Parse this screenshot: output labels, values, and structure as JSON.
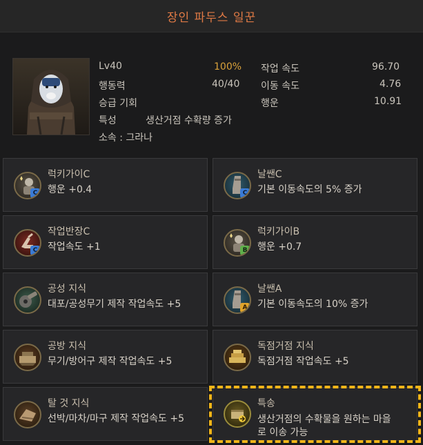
{
  "window": {
    "title": "장인 파두스 일꾼"
  },
  "worker": {
    "level": "Lv40",
    "level_percent": "100%",
    "stamina_label": "행동력",
    "stamina_value": "40/40",
    "promotion_label": "승급 기회",
    "trait_label": "특성",
    "trait_value": "생산거점 수확량 증가",
    "affiliation": "소속 : 그라나",
    "work_speed_label": "작업 속도",
    "work_speed_value": "96.70",
    "move_speed_label": "이동 속도",
    "move_speed_value": "4.76",
    "luck_label": "행운",
    "luck_value": "10.91"
  },
  "skills": [
    {
      "name": "럭키가이C",
      "desc": "행운 +0.4",
      "icon": "lucky-guy-icon",
      "grade": "C",
      "grade_color": "#3a7bd5"
    },
    {
      "name": "날쌘C",
      "desc": "기본 이동속도의 5% 증가",
      "icon": "swift-boot-icon",
      "grade": "C",
      "grade_color": "#3a7bd5"
    },
    {
      "name": "작업반장C",
      "desc": "작업속도 +1",
      "icon": "foreman-hand-icon",
      "grade": "C",
      "grade_color": "#3a7bd5"
    },
    {
      "name": "럭키가이B",
      "desc": "행운 +0.7",
      "icon": "lucky-guy-icon",
      "grade": "B",
      "grade_color": "#5fb04a"
    },
    {
      "name": "공성 지식",
      "desc": "대포/공성무기 제작 작업속도 +5",
      "icon": "siege-knowledge-icon",
      "grade": "",
      "grade_color": ""
    },
    {
      "name": "날쌘A",
      "desc": "기본 이동속도의 10% 증가",
      "icon": "swift-boot-icon",
      "grade": "A",
      "grade_color": "#e0a32a"
    },
    {
      "name": "공방 지식",
      "desc": "무기/방어구 제작 작업속도 +5",
      "icon": "workshop-knowledge-icon",
      "grade": "",
      "grade_color": ""
    },
    {
      "name": "독점거점 지식",
      "desc": "독점거점 작업속도 +5",
      "icon": "monopoly-knowledge-icon",
      "grade": "",
      "grade_color": ""
    },
    {
      "name": "탈 것 지식",
      "desc": "선박/마차/마구 제작 작업속도 +5",
      "icon": "vehicle-knowledge-icon",
      "grade": "",
      "grade_color": ""
    },
    {
      "name": "특송",
      "desc_line1": "생산거점의 수확물을 원하는 마을",
      "desc_line2": "로 이송 가능",
      "icon": "express-delivery-icon",
      "grade": "",
      "grade_color": ""
    }
  ],
  "colors": {
    "title": "#e07a45",
    "level_percent": "#d9a13a",
    "highlight_border": "#f2b519"
  }
}
